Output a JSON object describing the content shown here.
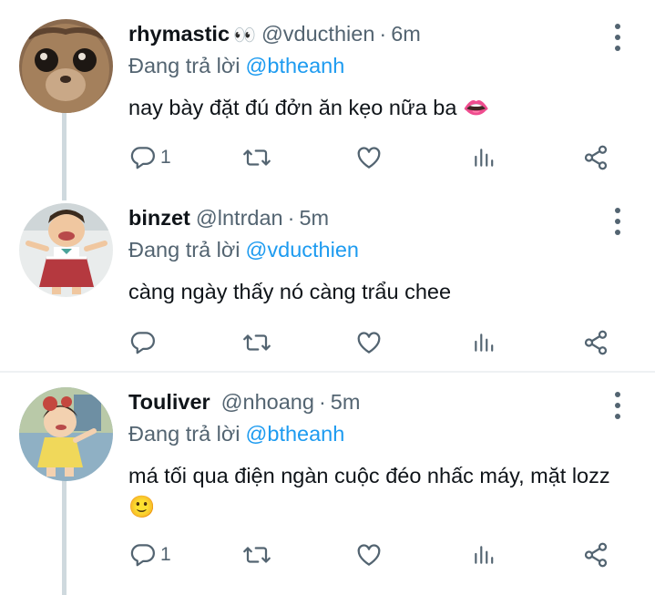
{
  "replying_prefix": "Đang trả lời",
  "tweets": [
    {
      "name": "rhymastic",
      "emoji": "👀",
      "handle": "@vducthien",
      "separator": "·",
      "time": "6m",
      "reply_to": "@btheanh",
      "text": "nay bày đặt đú đởn ăn kẹo nữa ba",
      "text_emoji": "👄",
      "reply_count": "1"
    },
    {
      "name": "binzet",
      "emoji": "",
      "handle": "@lntrdan",
      "separator": "·",
      "time": "5m",
      "reply_to": "@vducthien",
      "text": "càng ngày thấy nó càng trẩu chee",
      "text_emoji": "",
      "reply_count": ""
    },
    {
      "name": "Touliver",
      "emoji": "",
      "handle": "@nhoang",
      "separator": "·",
      "time": "5m",
      "reply_to": "@btheanh",
      "text": "má tối qua điện ngàn cuộc đéo nhấc máy, mặt lozz",
      "text_emoji": "🙂",
      "reply_count": "1"
    }
  ],
  "colors": {
    "text": "#0f1419",
    "secondary": "#536471",
    "link": "#1d9bf0",
    "thread_line": "#cfd9de"
  },
  "icons": [
    "reply-icon",
    "retweet-icon",
    "like-icon",
    "analytics-icon",
    "share-icon",
    "more-icon"
  ]
}
